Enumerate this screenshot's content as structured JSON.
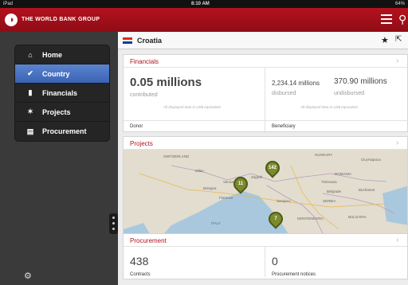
{
  "status_bar": {
    "device": "iPad",
    "time": "8:10 AM",
    "battery": "64%"
  },
  "app": {
    "brand": "THE WORLD BANK GROUP"
  },
  "sidebar": {
    "items": [
      {
        "label": "Home",
        "icon": "home-icon"
      },
      {
        "label": "Country",
        "icon": "check-circle-icon",
        "active": true
      },
      {
        "label": "Financials",
        "icon": "bar-chart-icon"
      },
      {
        "label": "Projects",
        "icon": "pin-icon"
      },
      {
        "label": "Procurement",
        "icon": "document-icon"
      }
    ]
  },
  "country": {
    "name": "Croatia",
    "flag_colors": [
      "#d52b1e",
      "#ffffff",
      "#1a3a8f"
    ]
  },
  "financials": {
    "title": "Financials",
    "donor_value": "0.05 millions",
    "donor_sub": "contributed",
    "donor_note": "All displayed data in US$ equivalent",
    "donor_label": "Donor",
    "disbursed_value": "2,234.14 millions",
    "disbursed_label": "disbursed",
    "undisbursed_value": "370.90 millions",
    "undisbursed_label": "undisbursed",
    "beneficiary_note": "All displayed data in US$ equivalent",
    "beneficiary_label": "Beneficiary"
  },
  "projects": {
    "title": "Projects",
    "pins": [
      "142",
      "11",
      "7"
    ],
    "map_labels": [
      "SWITZERLAND",
      "HUNGARY",
      "ROMANIA",
      "Milan",
      "Venice",
      "Bologna",
      "Florence",
      "ITALY",
      "Belgrade",
      "SERBIA",
      "Bucharest",
      "BULGARIA",
      "MONTENEGRO",
      "MACEDONIA",
      "Cluj-Napoca",
      "Timisoara",
      "Zagreb",
      "Sarajevo"
    ]
  },
  "procurement": {
    "title": "Procurement",
    "contracts_value": "438",
    "contracts_label": "Contracts",
    "notices_value": "0",
    "notices_label": "Procurement notices"
  },
  "colors": {
    "brand_red": "#b3121d",
    "active_blue": "#3a63b4",
    "pin_green": "#7c8a2e"
  }
}
